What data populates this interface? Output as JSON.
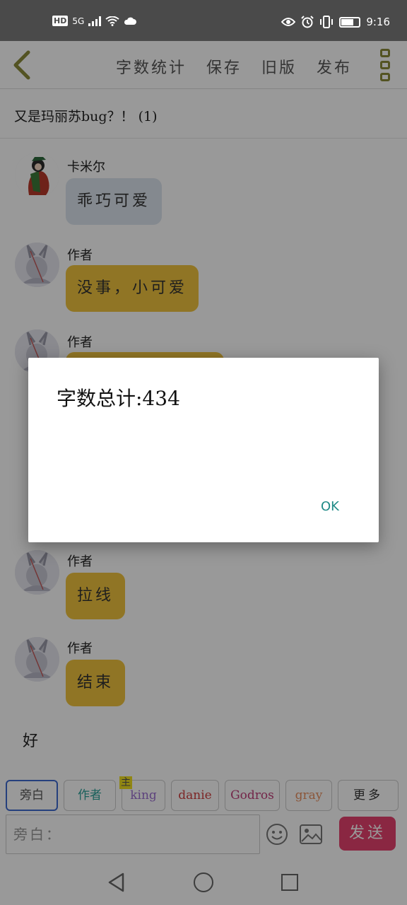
{
  "status_bar": {
    "left_badge": "HD",
    "network": "5G",
    "time": "9:16",
    "battery_level": 0.65
  },
  "header": {
    "actions": [
      "字数统计",
      "保存",
      "旧版",
      "发布"
    ]
  },
  "title": "又是玛丽苏bug？！ (1)",
  "messages": [
    {
      "sender": "卡米尔",
      "text": "乖巧可爱",
      "style": "gray"
    },
    {
      "sender": "作者",
      "text": "没事，小可爱",
      "style": "yellow"
    },
    {
      "sender": "作者",
      "text": "",
      "style": "yellow"
    },
    {
      "sender": "作者",
      "text": "拉线",
      "style": "yellow"
    },
    {
      "sender": "作者",
      "text": "结束",
      "style": "yellow"
    }
  ],
  "narration": "好",
  "tags": [
    {
      "label": "旁白",
      "color": "#555555",
      "selected": true
    },
    {
      "label": "作者",
      "color": "#2aa198",
      "selected": false
    },
    {
      "label": "king",
      "color": "#9b6fd0",
      "selected": false,
      "badge": "主"
    },
    {
      "label": "danie",
      "color": "#d04040",
      "selected": false
    },
    {
      "label": "Godros",
      "color": "#c0407a",
      "selected": false
    },
    {
      "label": "gray",
      "color": "#e89060",
      "selected": false
    },
    {
      "label": "更多",
      "color": "#333333",
      "selected": false
    }
  ],
  "input": {
    "placeholder": "旁白："
  },
  "send_label": "发送",
  "dialog": {
    "message": "字数总计:434",
    "ok_label": "OK"
  },
  "colors": {
    "accent_yellow": "#f0c43e",
    "send_pink": "#e7426f",
    "dialog_ok": "#1f8a86"
  }
}
